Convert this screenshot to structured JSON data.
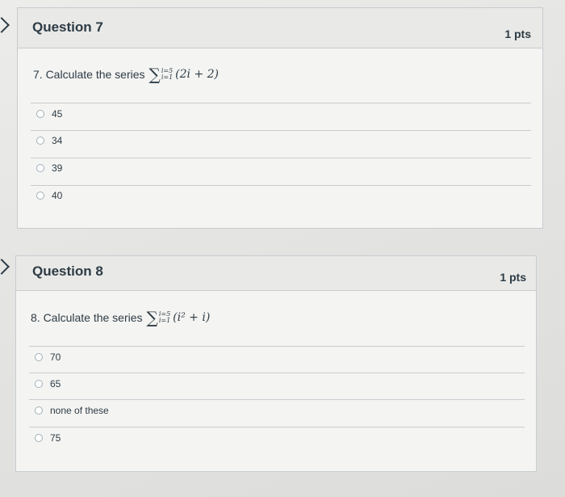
{
  "question7": {
    "title": "Question 7",
    "points": "1 pts",
    "prompt": "7. Calculate the series",
    "math": {
      "sigma": "∑",
      "upper": "i=5",
      "lower": "i=1",
      "expression": "(2i + 2)"
    },
    "answers": [
      {
        "label": "45"
      },
      {
        "label": "34"
      },
      {
        "label": "39"
      },
      {
        "label": "40"
      }
    ]
  },
  "question8": {
    "title": "Question 8",
    "points": "1 pts",
    "prompt": "8. Calculate the series",
    "math": {
      "sigma": "∑",
      "upper": "i=5",
      "lower": "i=1",
      "expression": "(i² + i)"
    },
    "answers": [
      {
        "label": "70"
      },
      {
        "label": "65"
      },
      {
        "label": "none of these"
      },
      {
        "label": "75"
      }
    ]
  }
}
